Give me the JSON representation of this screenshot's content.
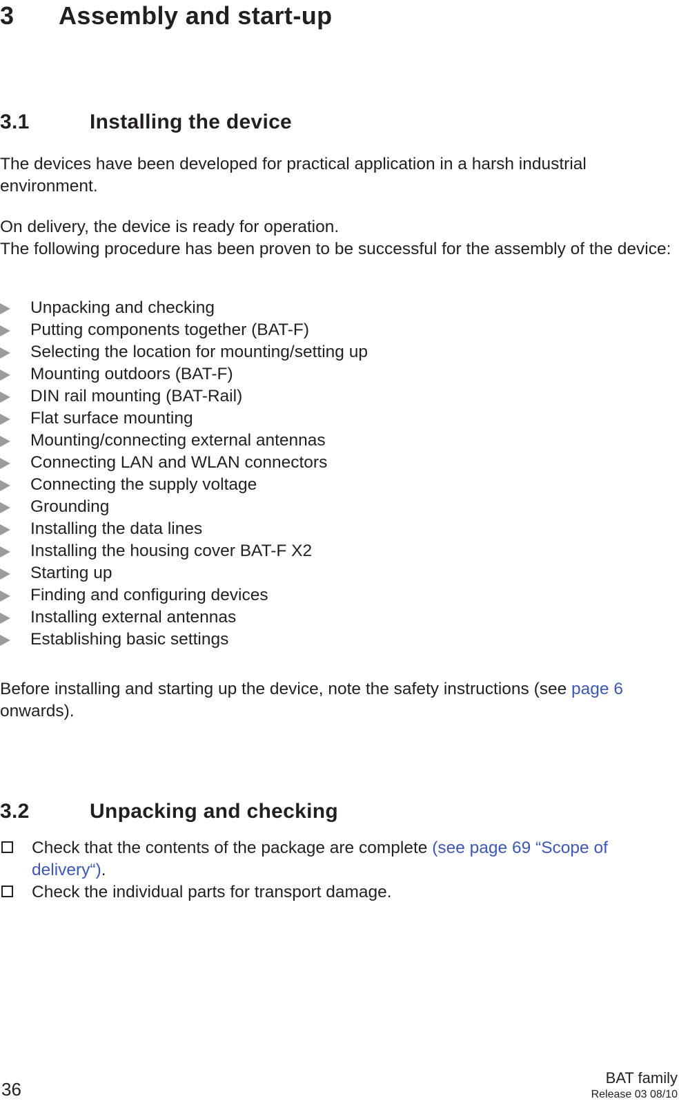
{
  "document": {
    "chapter_number": "3",
    "chapter_title": "Assembly and start-up"
  },
  "sections": {
    "installing": {
      "number": "3.1",
      "title": "Installing the device",
      "paragraph_1": "The devices have been developed for practical application in a harsh industrial environment.",
      "paragraph_2_line_1": "On delivery, the device is ready for operation.",
      "paragraph_2_line_2": "The following procedure has been proven to be successful for the assembly of the device:",
      "steps": [
        "Unpacking and checking",
        "Putting components together (BAT-F)",
        "Selecting the location for mounting/setting up",
        "Mounting outdoors (BAT-F)",
        "DIN rail mounting (BAT-Rail)",
        "Flat surface mounting",
        "Mounting/connecting external antennas",
        "Connecting LAN and WLAN connectors",
        "Connecting the supply voltage",
        "Grounding",
        "Installing the data lines",
        "Installing the housing cover BAT-F X2",
        "Starting up",
        "Finding and configuring devices",
        "Installing external antennas",
        "Establishing basic settings"
      ],
      "safety_note_before": "Before installing and starting up the device, note the safety instructions (see ",
      "safety_note_link": "page 6",
      "safety_note_after": " onwards)."
    },
    "unpacking": {
      "number": "3.2",
      "title": "Unpacking and checking",
      "checks": [
        {
          "text_before": "Check that the contents of the package are complete ",
          "link": "(see page 69 “Scope of delivery“)",
          "text_after": "."
        },
        {
          "text_before": "Check the individual parts for transport damage.",
          "link": "",
          "text_after": ""
        }
      ]
    }
  },
  "footer": {
    "page_number": "36",
    "product": "BAT family",
    "release": "Release  03  08/10"
  },
  "colors": {
    "text": "#231f20",
    "link": "#3c57b4",
    "bullet_arrow": "#9a9a9a"
  }
}
